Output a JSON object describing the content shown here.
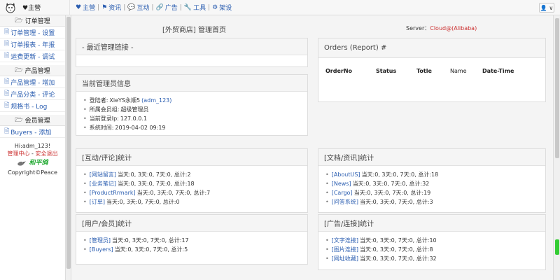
{
  "topbar": {
    "brand_home": "♥主營",
    "nav": [
      {
        "icon": "heart-icon",
        "glyph": "♥",
        "label": "主營"
      },
      {
        "icon": "flag-icon",
        "glyph": "⚑",
        "label": "资讯"
      },
      {
        "icon": "chat-icon",
        "glyph": "💬",
        "label": "互动"
      },
      {
        "icon": "link-icon",
        "glyph": "🔗",
        "label": "广告"
      },
      {
        "icon": "wrench-icon",
        "glyph": "🔧",
        "label": "工具"
      },
      {
        "icon": "gears-icon",
        "glyph": "⚙",
        "label": "架设"
      }
    ],
    "user_button": "👤 ∨"
  },
  "sidebar": {
    "groups": [
      {
        "title": "订单管理",
        "items": [
          "订单管理 - 设置",
          "订单报表 - 年报",
          "运费更新 - 调试"
        ]
      },
      {
        "title": "产品管理",
        "items": [
          "产品管理 - 增加",
          "产品分类 - 评论",
          "规格书 - Log"
        ]
      },
      {
        "title": "会员管理",
        "items": [
          "Buyers - 添加"
        ]
      }
    ],
    "hi_user": "Hi:adm_123!",
    "admin_center": "管理中心",
    "logout": "安全退出",
    "brand_script": "和平鸽",
    "copyright": "Copyright©Peace"
  },
  "main": {
    "page_title": "[外贸商店] 管理首页",
    "server_label": "Server：",
    "server_value": "Cloud@(Alibaba)",
    "recent_links": {
      "title": "- 最近管理链接 -"
    },
    "admin_info": {
      "title": "当前管理员信息",
      "rows": [
        {
          "label": "登陆者: ",
          "value": "XieYS永顺5",
          "link": "(adm_123)"
        },
        {
          "label": "所属会员组: ",
          "value": "超级管理员",
          "link": ""
        },
        {
          "label": "当前登录Ip: ",
          "value": "127.0.0.1",
          "link": ""
        },
        {
          "label": "系统时间: ",
          "value": "2019-04-02 09:19",
          "link": ""
        }
      ]
    },
    "orders": {
      "title": "Orders (Report) #",
      "columns": [
        "OrderNo",
        "Status",
        "Totle",
        "Name",
        "Date-Time"
      ]
    },
    "interact_stats": {
      "title": "[互动/评论]统计",
      "rows": [
        {
          "link": "[网站留言]",
          "text": "当天:0, 3天:0, 7天:0, 总计:2"
        },
        {
          "link": "[业务笔记]",
          "text": "当天:0, 3天:0, 7天:0, 总计:18"
        },
        {
          "link": "[ProductRrmark]",
          "text": "当天:0, 3天:0, 7天:0, 总计:7"
        },
        {
          "link": "[订单]",
          "text": "当天:0, 3天:0, 7天:0, 总计:0"
        }
      ]
    },
    "doc_stats": {
      "title": "[文档/资讯]统计",
      "rows": [
        {
          "link": "[AboutUS]",
          "text": "当天:0, 3天:0, 7天:0, 总计:18"
        },
        {
          "link": "[News]",
          "text": "当天:0, 3天:0, 7天:0, 总计:32"
        },
        {
          "link": "[Cargo]",
          "text": "当天:0, 3天:0, 7天:0, 总计:19"
        },
        {
          "link": "[问答系统]",
          "text": "当天:0, 3天:0, 7天:0, 总计:3"
        }
      ]
    },
    "user_stats": {
      "title": "[用户/会员]统计",
      "rows": [
        {
          "link": "[管理员]",
          "text": "当天:0, 3天:0, 7天:0, 总计:17"
        },
        {
          "link": "[Buyers]",
          "text": "当天:0, 3天:0, 7天:0, 总计:5"
        }
      ]
    },
    "ad_stats": {
      "title": "[广告/连接]统计",
      "rows": [
        {
          "link": "[文字连接]",
          "text": "当天:0, 3天:0, 7天:0, 总计:10"
        },
        {
          "link": "[图片连接]",
          "text": "当天:0, 3天:0, 7天:0, 总计:8"
        },
        {
          "link": "[网址收藏]",
          "text": "当天:0, 3天:0, 7天:0, 总计:32"
        }
      ]
    }
  },
  "colors": {
    "link": "#2a5db0",
    "accent_red": "#cc3333",
    "panel_head": "#f5f5f5"
  }
}
